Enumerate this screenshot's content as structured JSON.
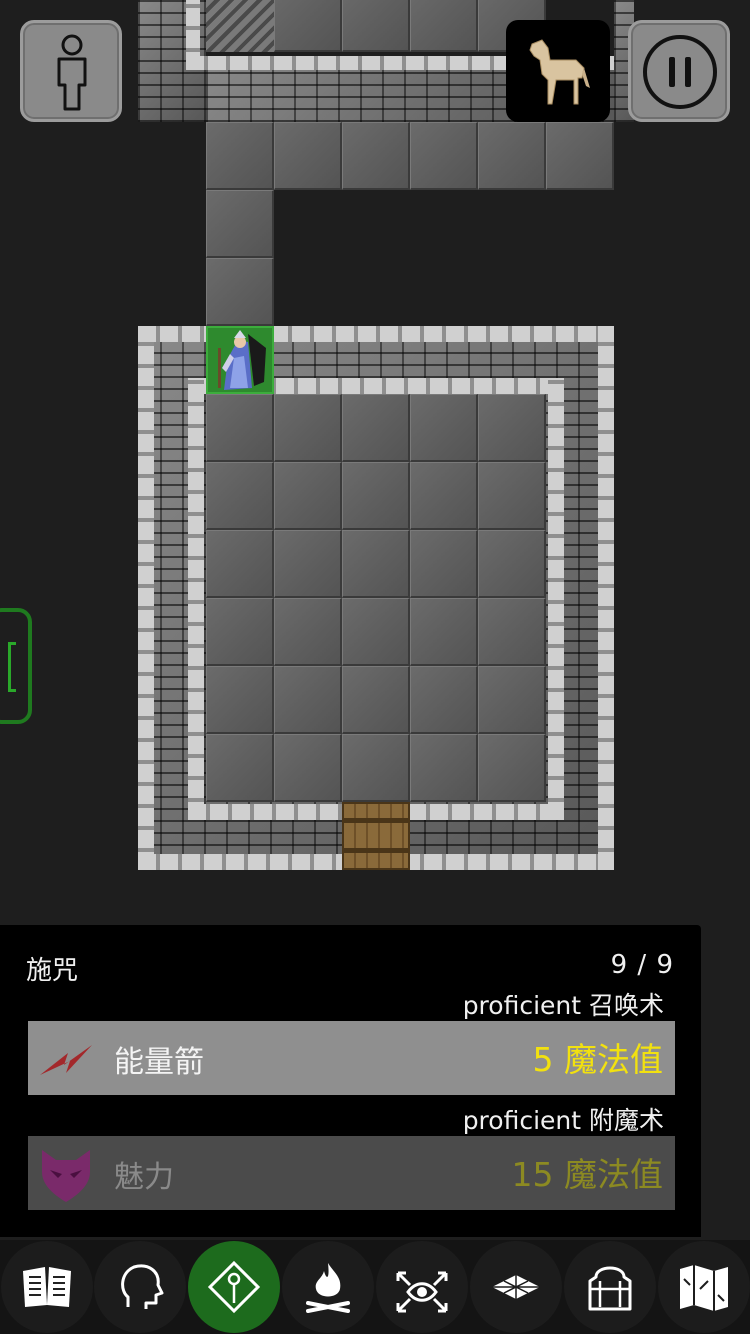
{
  "spell_panel": {
    "title": "施咒",
    "count": "9 / 9",
    "groups": [
      {
        "school": "proficient 召唤术",
        "spell": {
          "name": "能量箭",
          "cost": "5 魔法值",
          "icon": "lightning-bolt-icon",
          "available": true
        }
      },
      {
        "school": "proficient 附魔术",
        "spell": {
          "name": "魅力",
          "cost": "15 魔法值",
          "icon": "heart-mask-icon",
          "available": false
        }
      }
    ]
  },
  "hud": {
    "character_button_icon": "person-icon",
    "companion_icon": "horse-icon",
    "pause_icon": "pause-icon",
    "side_handle_icon": "bracket-handle-icon"
  },
  "toolbar": {
    "tools": [
      {
        "icon": "book-icon",
        "active": false
      },
      {
        "icon": "head-icon",
        "active": false
      },
      {
        "icon": "magic-staff-icon",
        "active": true
      },
      {
        "icon": "campfire-icon",
        "active": false
      },
      {
        "icon": "look-eye-icon",
        "active": false
      },
      {
        "icon": "floor-tile-icon",
        "active": false
      },
      {
        "icon": "inventory-bag-icon",
        "active": false
      },
      {
        "icon": "map-icon",
        "active": false
      }
    ]
  },
  "colors": {
    "accent_green": "#1d6b1d",
    "cost_yellow": "#f2e10f",
    "spell_row": "#8f8f8f",
    "spell_row_disabled": "#4b4b4b"
  }
}
